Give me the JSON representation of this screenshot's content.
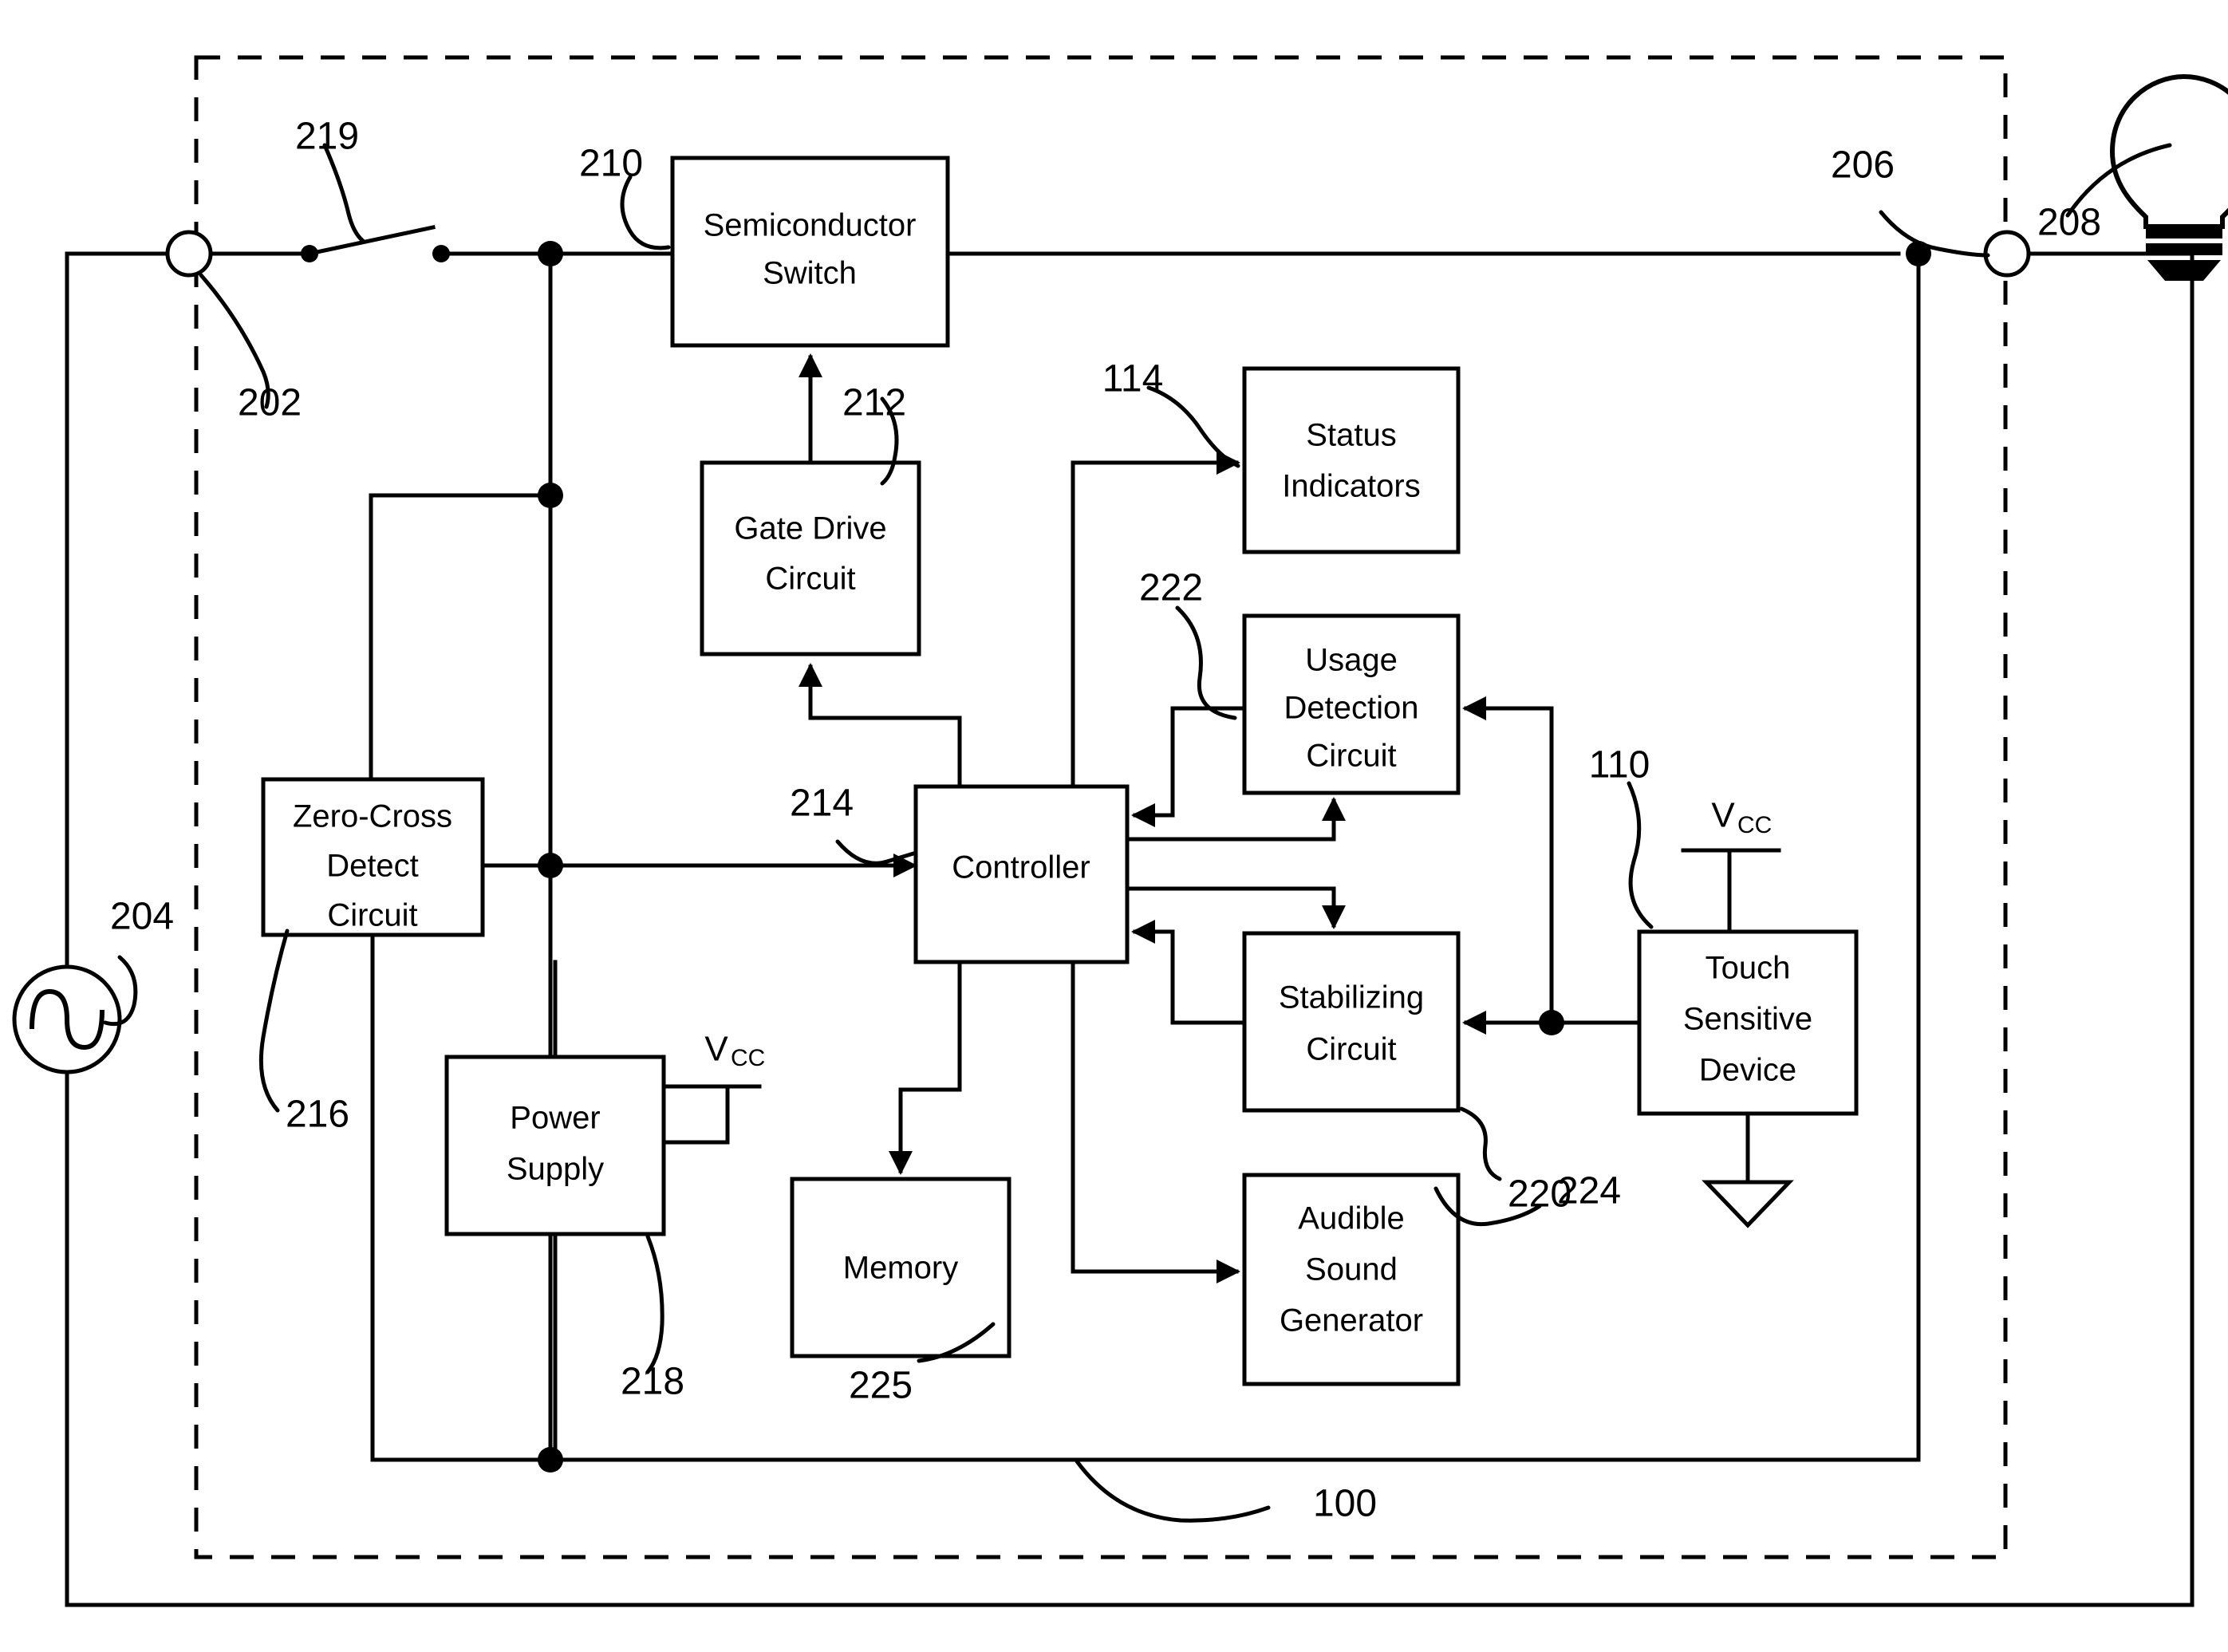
{
  "figure": {
    "type": "patent-block-diagram",
    "title_visible": false
  },
  "blocks": [
    {
      "id": "semiconductor-switch",
      "lines": [
        "Semiconductor",
        "Switch"
      ],
      "ref": "210"
    },
    {
      "id": "gate-drive-circuit",
      "lines": [
        "Gate Drive",
        "Circuit"
      ],
      "ref": "212"
    },
    {
      "id": "zero-cross-detect-circuit",
      "lines": [
        "Zero-Cross",
        "Detect",
        "Circuit"
      ],
      "ref": "216"
    },
    {
      "id": "power-supply",
      "lines": [
        "Power",
        "Supply"
      ],
      "ref": "218"
    },
    {
      "id": "controller",
      "lines": [
        "Controller"
      ],
      "ref": "214"
    },
    {
      "id": "memory",
      "lines": [
        "Memory"
      ],
      "ref": "225"
    },
    {
      "id": "status-indicators",
      "lines": [
        "Status",
        "Indicators"
      ],
      "ref": "114"
    },
    {
      "id": "usage-detection-circuit",
      "lines": [
        "Usage",
        "Detection",
        "Circuit"
      ],
      "ref": "222"
    },
    {
      "id": "stabilizing-circuit",
      "lines": [
        "Stabilizing",
        "Circuit"
      ],
      "ref": "220"
    },
    {
      "id": "audible-sound-generator",
      "lines": [
        "Audible",
        "Sound",
        "Generator"
      ],
      "ref": "224"
    },
    {
      "id": "touch-sensitive-device",
      "lines": [
        "Touch",
        "Sensitive",
        "Device"
      ],
      "ref": "110"
    }
  ],
  "reference_numerals": {
    "r100": "100",
    "r110": "110",
    "r114": "114",
    "r202": "202",
    "r204": "204",
    "r206": "206",
    "r208": "208",
    "r210": "210",
    "r212": "212",
    "r214": "214",
    "r216": "216",
    "r218": "218",
    "r219": "219",
    "r220": "220",
    "r222": "222",
    "r224": "224",
    "r225": "225"
  },
  "symbols": {
    "vcc_main": "V",
    "vcc_sub": "CC",
    "ac_source_ref": "204",
    "lamp_ref": "208",
    "terminal_left_ref": "202",
    "terminal_right_ref": "206",
    "mechanical_switch_ref": "219",
    "enclosure_ref": "100",
    "ground_symbol": "earth-ground-triangle"
  },
  "block_text": {
    "semiconductor_switch_l1": "Semiconductor",
    "semiconductor_switch_l2": "Switch",
    "gate_drive_l1": "Gate Drive",
    "gate_drive_l2": "Circuit",
    "zero_cross_l1": "Zero-Cross",
    "zero_cross_l2": "Detect",
    "zero_cross_l3": "Circuit",
    "power_supply_l1": "Power",
    "power_supply_l2": "Supply",
    "controller_l1": "Controller",
    "memory_l1": "Memory",
    "status_indicators_l1": "Status",
    "status_indicators_l2": "Indicators",
    "usage_detection_l1": "Usage",
    "usage_detection_l2": "Detection",
    "usage_detection_l3": "Circuit",
    "stabilizing_l1": "Stabilizing",
    "stabilizing_l2": "Circuit",
    "audible_l1": "Audible",
    "audible_l2": "Sound",
    "audible_l3": "Generator",
    "touch_l1": "Touch",
    "touch_l2": "Sensitive",
    "touch_l3": "Device",
    "vcc_ps_main": "V",
    "vcc_ps_sub": "CC",
    "vcc_touch_main": "V",
    "vcc_touch_sub": "CC"
  }
}
